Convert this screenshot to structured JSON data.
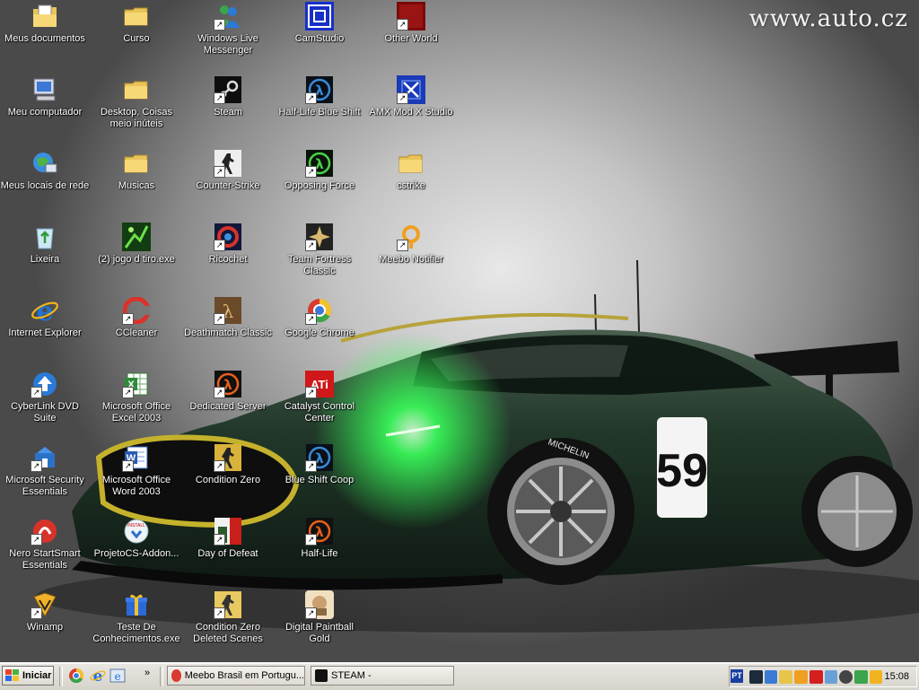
{
  "watermark": "www.auto.cz",
  "desktop": {
    "icons": [
      {
        "label": "Meus documentos",
        "icon": "my-documents-icon",
        "shortcut": false
      },
      {
        "label": "Meu computador",
        "icon": "my-computer-icon",
        "shortcut": false
      },
      {
        "label": "Meus locais de rede",
        "icon": "network-places-icon",
        "shortcut": false
      },
      {
        "label": "Lixeira",
        "icon": "recycle-bin-icon",
        "shortcut": false
      },
      {
        "label": "Internet Explorer",
        "icon": "internet-explorer-icon",
        "shortcut": false
      },
      {
        "label": "CyberLink DVD Suite",
        "icon": "cyberlink-dvd-suite-icon",
        "shortcut": true
      },
      {
        "label": "Microsoft Security Essentials",
        "icon": "security-essentials-icon",
        "shortcut": true
      },
      {
        "label": "Nero StartSmart Essentials",
        "icon": "nero-icon",
        "shortcut": true
      },
      {
        "label": "Winamp",
        "icon": "winamp-icon",
        "shortcut": true
      },
      {
        "label": "Curso",
        "icon": "folder-icon",
        "shortcut": false
      },
      {
        "label": "Desktop, Coisas meio inúteis",
        "icon": "folder-icon",
        "shortcut": false
      },
      {
        "label": "Musicas",
        "icon": "folder-icon",
        "shortcut": false
      },
      {
        "label": "(2) jogo d tiro.exe",
        "icon": "game-exe-icon",
        "shortcut": false
      },
      {
        "label": "CCleaner",
        "icon": "ccleaner-icon",
        "shortcut": true
      },
      {
        "label": "Microsoft Office Excel 2003",
        "icon": "excel-icon",
        "shortcut": true
      },
      {
        "label": "Microsoft Office Word 2003",
        "icon": "word-icon",
        "shortcut": true
      },
      {
        "label": "ProjetoCS-Addon...",
        "icon": "projetocs-icon",
        "shortcut": false
      },
      {
        "label": "Teste De Conhecimentos.exe",
        "icon": "gift-exe-icon",
        "shortcut": false
      },
      {
        "label": "Windows Live Messenger",
        "icon": "messenger-icon",
        "shortcut": true
      },
      {
        "label": "Steam",
        "icon": "steam-icon",
        "shortcut": true
      },
      {
        "label": "Counter-Strike",
        "icon": "counter-strike-icon",
        "shortcut": true
      },
      {
        "label": "Ricochet",
        "icon": "ricochet-icon",
        "shortcut": true
      },
      {
        "label": "Deathmatch Classic",
        "icon": "deathmatch-classic-icon",
        "shortcut": true
      },
      {
        "label": "Dedicated Server",
        "icon": "dedicated-server-icon",
        "shortcut": true
      },
      {
        "label": "Condition Zero",
        "icon": "condition-zero-icon",
        "shortcut": true
      },
      {
        "label": "Day of Defeat",
        "icon": "day-of-defeat-icon",
        "shortcut": true
      },
      {
        "label": "Condition Zero Deleted Scenes",
        "icon": "condition-zero-deleted-scenes-icon",
        "shortcut": true
      },
      {
        "label": "CamStudio",
        "icon": "camstudio-icon",
        "shortcut": false
      },
      {
        "label": "Half-Life Blue Shift",
        "icon": "blue-shift-icon",
        "shortcut": true
      },
      {
        "label": "Opposing Force",
        "icon": "opposing-force-icon",
        "shortcut": true
      },
      {
        "label": "Team Fortress Classic",
        "icon": "team-fortress-classic-icon",
        "shortcut": true
      },
      {
        "label": "Google Chrome",
        "icon": "google-chrome-icon",
        "shortcut": true
      },
      {
        "label": "Catalyst Control Center",
        "icon": "ati-catalyst-icon",
        "shortcut": true
      },
      {
        "label": "Blue Shift Coop",
        "icon": "blue-shift-coop-icon",
        "shortcut": true
      },
      {
        "label": "Half-Life",
        "icon": "half-life-icon",
        "shortcut": true
      },
      {
        "label": "Digital Paintball Gold",
        "icon": "digital-paintball-icon",
        "shortcut": true
      },
      {
        "label": "Other World",
        "icon": "other-world-icon",
        "shortcut": true
      },
      {
        "label": "AMX Mod X Studio",
        "icon": "amx-mod-x-studio-icon",
        "shortcut": true
      },
      {
        "label": "cstrike",
        "icon": "folder-icon",
        "shortcut": false
      },
      {
        "label": "Meebo Notifier",
        "icon": "meebo-notifier-icon",
        "shortcut": true
      }
    ]
  },
  "car": {
    "number": "59",
    "tire_text": "MICHELIN"
  },
  "taskbar": {
    "start_label": "Iniciar",
    "tasks": [
      {
        "label": "Meebo Brasil em Portugu...",
        "icon": "chrome-icon"
      },
      {
        "label": "STEAM -",
        "icon": "steam-icon"
      }
    ],
    "language": "PT",
    "clock": "15:08"
  },
  "colors": {
    "taskbar": "#d6d3ca",
    "car_body": "#1e3324",
    "headlight": "#39ff5a",
    "folder": "#f3d36a"
  }
}
